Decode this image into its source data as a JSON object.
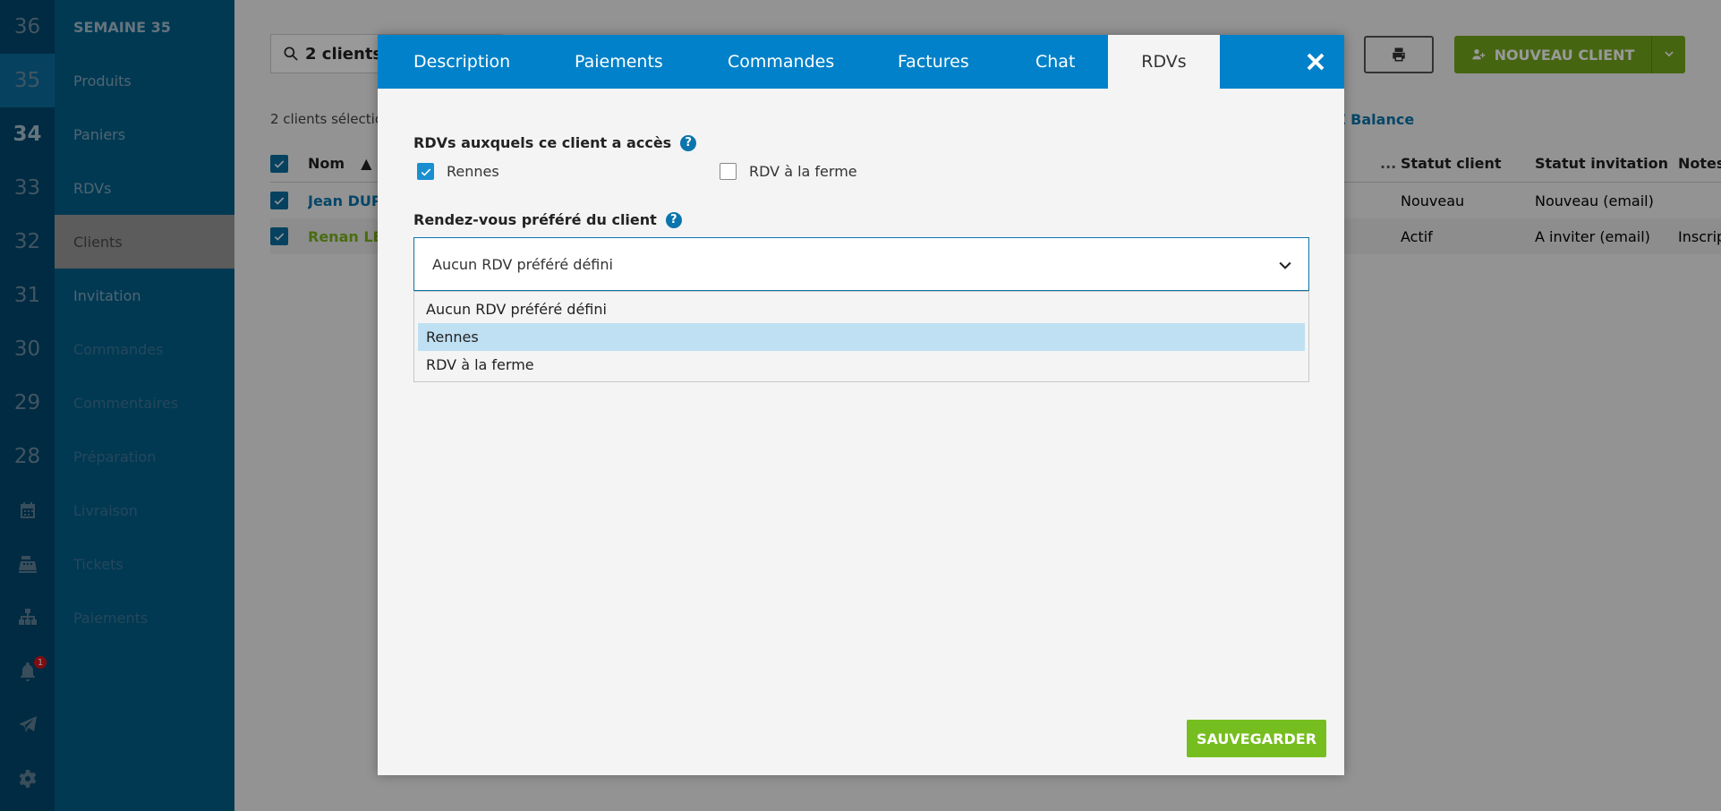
{
  "rail": {
    "weeks": [
      "36",
      "35",
      "34",
      "33",
      "32",
      "31",
      "30",
      "29",
      "28"
    ],
    "notification_count": "1",
    "icons": [
      "calendar-icon",
      "cash-register-icon",
      "sitemap-icon",
      "bell-icon",
      "paper-plane-icon",
      "gear-icon"
    ]
  },
  "sidebar": {
    "header": "SEMAINE 35",
    "items": [
      {
        "label": "Produits"
      },
      {
        "label": "Paniers"
      },
      {
        "label": "RDVs"
      },
      {
        "label": "Clients"
      },
      {
        "label": "Invitation"
      },
      {
        "label": "Commandes"
      },
      {
        "label": "Commentaires"
      },
      {
        "label": "Préparation"
      },
      {
        "label": "Livraison"
      },
      {
        "label": "Tickets"
      },
      {
        "label": "Paiements"
      }
    ]
  },
  "main": {
    "search_text": "2 clients",
    "selection_text": "2 clients sélectio",
    "balance_link": "Z Balance",
    "new_client_label": "NOUVEAU CLIENT",
    "table": {
      "headers": {
        "name": "Nom",
        "sort": "▲",
        "dots": "...",
        "status": "Statut client",
        "invitation": "Statut invitation",
        "notes": "Notes"
      },
      "rows": [
        {
          "name": "Jean DUPC",
          "status": "Nouveau",
          "invitation": "Nouveau (email)",
          "notes": ""
        },
        {
          "name": "Renan LE (",
          "status": "Actif",
          "invitation": "A inviter (email)",
          "notes": "Inscrip"
        }
      ]
    }
  },
  "modal": {
    "tabs": [
      {
        "label": "Description"
      },
      {
        "label": "Paiements"
      },
      {
        "label": "Commandes"
      },
      {
        "label": "Factures"
      },
      {
        "label": "Chat"
      },
      {
        "label": "RDVs"
      }
    ],
    "access_label": "RDVs auxquels ce client a accès",
    "access_options": [
      {
        "label": "Rennes",
        "checked": true
      },
      {
        "label": "RDV à la ferme",
        "checked": false
      }
    ],
    "preferred_label": "Rendez-vous préféré du client",
    "preferred_selected": "Aucun RDV préféré défini",
    "preferred_options": [
      "Aucun RDV préféré défini",
      "Rennes",
      "RDV à la ferme"
    ],
    "highlighted_option": "Rennes",
    "help_glyph": "?",
    "save_label": "SAUVEGARDER"
  }
}
